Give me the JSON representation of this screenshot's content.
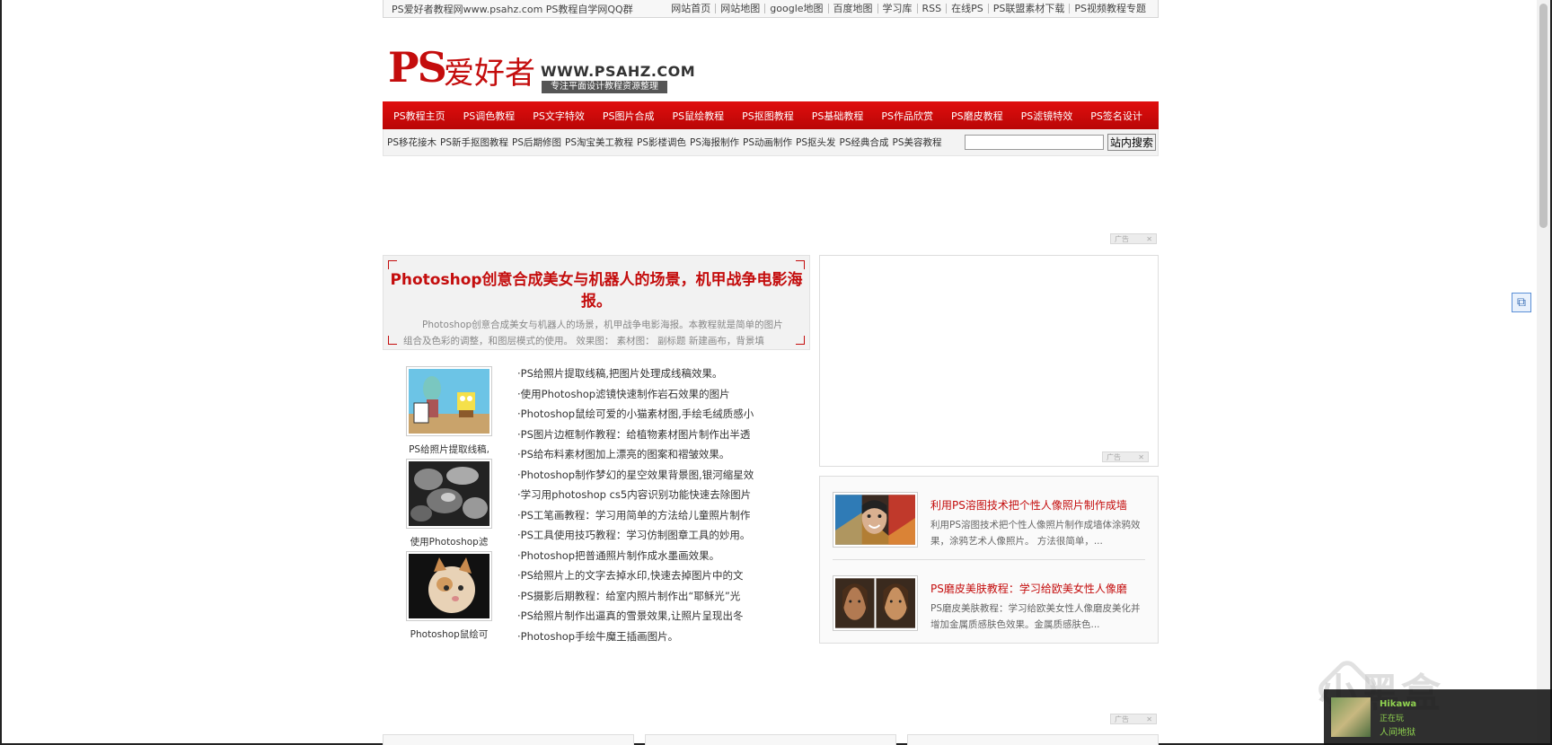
{
  "topbar": {
    "site_text": "PS爱好者教程网www.psahz.com PS教程自学网QQ群",
    "links": [
      "网站首页",
      "网站地图",
      "google地图",
      "百度地图",
      "学习库",
      "RSS",
      "在线PS",
      "PS联盟素材下载",
      "PS视频教程专题"
    ]
  },
  "logo": {
    "ps": "PS",
    "cn": "爱好者",
    "url": "WWW.PSAHZ.COM",
    "slogan": "专注平面设计教程资源整理"
  },
  "nav": {
    "items": [
      "PS教程主页",
      "PS调色教程",
      "PS文字特效",
      "PS图片合成",
      "PS鼠绘教程",
      "PS抠图教程",
      "PS基础教程",
      "PS作品欣赏",
      "PS磨皮教程",
      "PS滤镜特效",
      "PS签名设计"
    ]
  },
  "subnav": {
    "items": [
      "PS移花接木",
      "PS新手抠图教程",
      "PS后期修图",
      "PS淘宝美工教程",
      "PS影楼调色",
      "PS海报制作",
      "PS动画制作",
      "PS抠头发",
      "PS经典合成",
      "PS美容教程"
    ]
  },
  "search": {
    "value": "",
    "button_label": "站内搜索"
  },
  "ad_label": "广告",
  "feature": {
    "title": "Photoshop创意合成美女与机器人的场景，机甲战争电影海报。",
    "summary": "Photoshop创意合成美女与机器人的场景，机甲战争电影海报。本教程就是简单的图片组合及色彩的调整，和图层模式的使用。 效果图： 素材图： 副标题 新建画布，背景填"
  },
  "thumbs": [
    {
      "caption": "PS给照片提取线稿,"
    },
    {
      "caption": "使用Photoshop滤"
    },
    {
      "caption": "Photoshop鼠绘可"
    }
  ],
  "articles": [
    "·PS给照片提取线稿,把图片处理成线稿效果。",
    "·使用Photoshop滤镜快速制作岩石效果的图片",
    "·Photoshop鼠绘可爱的小猫素材图,手绘毛绒质感小",
    "·PS图片边框制作教程：给植物素材图片制作出半透",
    "·PS给布料素材图加上漂亮的图案和褶皱效果。",
    "·Photoshop制作梦幻的星空效果背景图,银河缩星效",
    "·学习用photoshop cs5内容识别功能快速去除图片",
    "·PS工笔画教程：学习用简单的方法给儿童照片制作",
    "·PS工具使用技巧教程：学习仿制图章工具的妙用。",
    "·Photoshop把普通照片制作成水墨画效果。",
    "·PS给照片上的文字去掉水印,快速去掉图片中的文",
    "·PS摄影后期教程：给室内照片制作出“耶稣光”光",
    "·PS给照片制作出逼真的雪景效果,让照片呈现出冬",
    "·Photoshop手绘牛魔王插画图片。"
  ],
  "recommend": [
    {
      "title": "利用PS溶图技术把个性人像照片制作成墙",
      "desc": "利用PS溶图技术把个性人像照片制作成墙体涂鸦效果，涂鸦艺术人像照片。 方法很简单，..."
    },
    {
      "title": "PS磨皮美肤教程：学习给欧美女性人像磨",
      "desc": "PS磨皮美肤教程：学习给欧美女性人像磨皮美化并增加金属质感肤色效果。金属质感肤色..."
    }
  ],
  "overlay": {
    "watermark": "小黑盒",
    "user": "Hikawa",
    "status": "正在玩",
    "game": "人间地狱"
  }
}
